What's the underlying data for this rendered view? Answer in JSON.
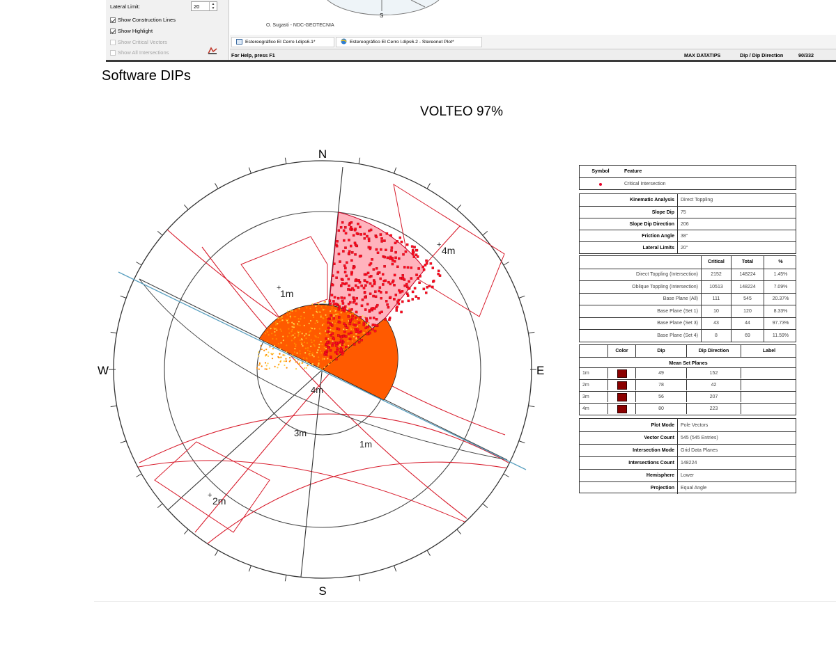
{
  "top_window": {
    "left_panel": {
      "lateral_limit_label": "Lateral Limit:",
      "lateral_limit_value": "20",
      "options": [
        {
          "label": "Show Construction Lines",
          "checked": true,
          "enabled": true
        },
        {
          "label": "Show Highlight",
          "checked": true,
          "enabled": true
        },
        {
          "label": "Show Critical Vectors",
          "checked": false,
          "enabled": false
        },
        {
          "label": "Show All Intersections",
          "checked": false,
          "enabled": false
        }
      ]
    },
    "plot_fragment": {
      "south_label": "S",
      "credit": "O. Sugasti   -   NDC-GEOTECNIA"
    },
    "tabs": [
      {
        "label": "Estereográfico El Cerro l.dips6.1*"
      },
      {
        "label": "Estereográfico El Cerro l.dips6.2 - Stereonet Plot*"
      }
    ],
    "status": {
      "help": "For Help, press F1",
      "max_datatips": "MAX DATATIPS",
      "mode": "Dip / Dip Direction",
      "value": "90/332"
    }
  },
  "caption": "Software DIPs",
  "title": "VOLTEO 97%",
  "stereonet": {
    "compass": {
      "north": "N",
      "south": "S",
      "east": "E",
      "west": "W"
    },
    "set_labels": {
      "set1_pole": "1m",
      "set1_plane": "1m",
      "set2_pole": "2m",
      "set3_plane": "3m",
      "set4_pole": "4m",
      "set4_plane": "4m"
    },
    "colors": {
      "zone": "#ff0033",
      "dots": "#ff2a00",
      "plane_red": "#d81c2c",
      "slope": "#5aa0c0",
      "intersections": "#ff7a00"
    }
  },
  "info_table": {
    "legend": {
      "headers": [
        "Symbol",
        "Feature"
      ],
      "rows": [
        {
          "feature": "Critical Intersection"
        }
      ]
    },
    "kinematic": [
      {
        "label": "Kinematic Analysis",
        "value": "Direct Toppling"
      },
      {
        "label": "Slope Dip",
        "value": "75"
      },
      {
        "label": "Slope Dip Direction",
        "value": "206"
      },
      {
        "label": "Friction Angle",
        "value": "38°"
      },
      {
        "label": "Lateral Limits",
        "value": "20°"
      }
    ],
    "results_headers": [
      "Critical",
      "Total",
      "%"
    ],
    "results": [
      {
        "label": "Direct Toppling (Intersection)",
        "critical": "2152",
        "total": "148224",
        "pct": "1.45%"
      },
      {
        "label": "Oblique Toppling (Intersection)",
        "critical": "10513",
        "total": "148224",
        "pct": "7.09%"
      },
      {
        "label": "Base Plane (All)",
        "critical": "111",
        "total": "545",
        "pct": "20.37%"
      },
      {
        "label": "Base Plane (Set 1)",
        "critical": "10",
        "total": "120",
        "pct": "8.33%"
      },
      {
        "label": "Base Plane (Set 3)",
        "critical": "43",
        "total": "44",
        "pct": "97.73%"
      },
      {
        "label": "Base Plane (Set 4)",
        "critical": "8",
        "total": "69",
        "pct": "11.59%"
      }
    ],
    "sets_headers": [
      "Color",
      "Dip",
      "Dip Direction",
      "Label"
    ],
    "sets_title": "Mean Set Planes",
    "sets": [
      {
        "id": "1m",
        "dip": "49",
        "dip_direction": "152",
        "color": "#8b0000"
      },
      {
        "id": "2m",
        "dip": "78",
        "dip_direction": "42",
        "color": "#8b0000"
      },
      {
        "id": "3m",
        "dip": "56",
        "dip_direction": "207",
        "color": "#8b0000"
      },
      {
        "id": "4m",
        "dip": "80",
        "dip_direction": "223",
        "color": "#8b0000"
      }
    ],
    "plot_info": [
      {
        "label": "Plot Mode",
        "value": "Pole Vectors"
      },
      {
        "label": "Vector Count",
        "value": "545 (545 Entries)"
      },
      {
        "label": "Intersection Mode",
        "value": "Grid Data Planes"
      },
      {
        "label": "Intersections Count",
        "value": "148224"
      },
      {
        "label": "Hemisphere",
        "value": "Lower"
      },
      {
        "label": "Projection",
        "value": "Equal Angle"
      }
    ]
  }
}
